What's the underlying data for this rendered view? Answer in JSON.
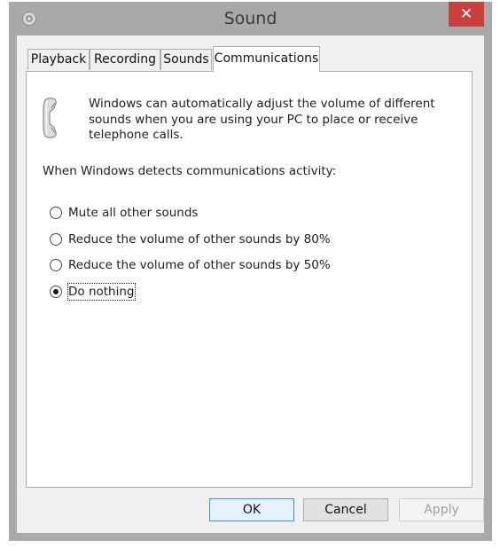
{
  "window": {
    "title": "Sound",
    "close_label": "✕"
  },
  "tabs": [
    {
      "label": "Playback",
      "active": false
    },
    {
      "label": "Recording",
      "active": false
    },
    {
      "label": "Sounds",
      "active": false
    },
    {
      "label": "Communications",
      "active": true
    }
  ],
  "communications": {
    "intro_icon": "telephone-handset-icon",
    "intro_lines": [
      "Windows can automatically adjust the volume of different",
      "sounds when you are using your PC to place or receive",
      "telephone calls."
    ],
    "question": "When Windows detects communications activity:",
    "options": [
      {
        "label": "Mute all other sounds",
        "selected": false
      },
      {
        "label": "Reduce the volume of other sounds by 80%",
        "selected": false
      },
      {
        "label": "Reduce the volume of other sounds by 50%",
        "selected": false
      },
      {
        "label": "Do nothing",
        "selected": true
      }
    ]
  },
  "buttons": {
    "ok": "OK",
    "cancel": "Cancel",
    "apply": "Apply"
  },
  "colors": {
    "close_button": "#c9413d",
    "frame": "#a9a9a9",
    "default_button_border": "#3c8fdc"
  }
}
